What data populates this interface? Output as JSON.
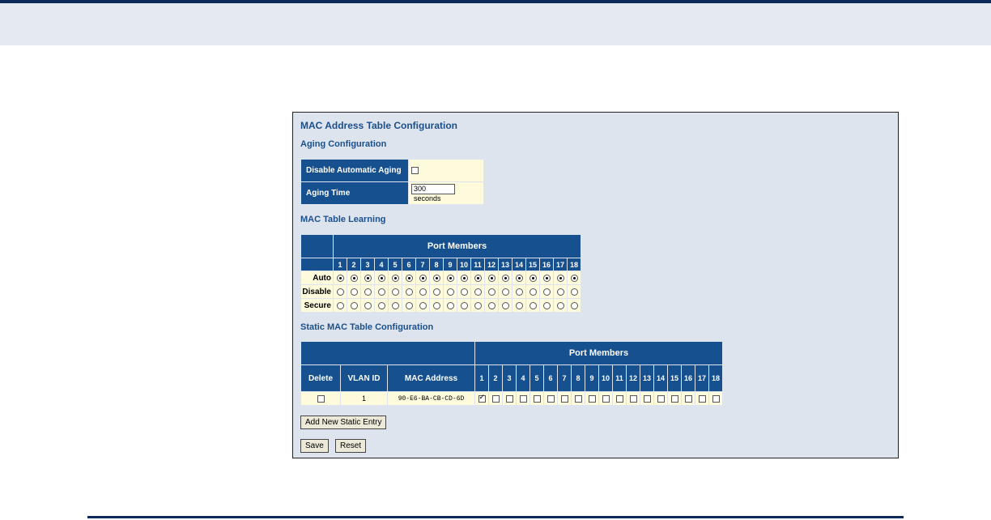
{
  "page": {
    "title": "MAC Address Table Configuration",
    "aging_heading": "Aging Configuration",
    "learning_heading": "MAC Table Learning",
    "static_heading": "Static MAC Table Configuration"
  },
  "aging": {
    "disable_label": "Disable Automatic Aging",
    "disable_checked": false,
    "time_label": "Aging Time",
    "time_value": "300",
    "time_units": "seconds"
  },
  "learning": {
    "port_members_label": "Port Members",
    "ports": [
      "1",
      "2",
      "3",
      "4",
      "5",
      "6",
      "7",
      "8",
      "9",
      "10",
      "11",
      "12",
      "13",
      "14",
      "15",
      "16",
      "17",
      "18"
    ],
    "rows": [
      {
        "label": "Auto",
        "key": "auto"
      },
      {
        "label": "Disable",
        "key": "disable"
      },
      {
        "label": "Secure",
        "key": "secure"
      }
    ],
    "selected": [
      "auto",
      "auto",
      "auto",
      "auto",
      "auto",
      "auto",
      "auto",
      "auto",
      "auto",
      "auto",
      "auto",
      "auto",
      "auto",
      "auto",
      "auto",
      "auto",
      "auto",
      "auto"
    ]
  },
  "static": {
    "headers": {
      "delete": "Delete",
      "vlan_id": "VLAN ID",
      "mac_address": "MAC Address",
      "port_members": "Port Members"
    },
    "ports": [
      "1",
      "2",
      "3",
      "4",
      "5",
      "6",
      "7",
      "8",
      "9",
      "10",
      "11",
      "12",
      "13",
      "14",
      "15",
      "16",
      "17",
      "18"
    ],
    "entries": [
      {
        "delete": false,
        "vlan_id": "1",
        "mac": "90-E6-BA-CB-CD-6D",
        "ports": [
          true,
          false,
          false,
          false,
          false,
          false,
          false,
          false,
          false,
          false,
          false,
          false,
          false,
          false,
          false,
          false,
          false,
          false
        ]
      }
    ]
  },
  "buttons": {
    "add_entry": "Add New Static Entry",
    "save": "Save",
    "reset": "Reset"
  },
  "colors": {
    "header_bg": "#16508e",
    "panel_bg": "#dde4ee",
    "cell_bg": "#fdfbdc",
    "heading_text": "#1b4f8a"
  }
}
